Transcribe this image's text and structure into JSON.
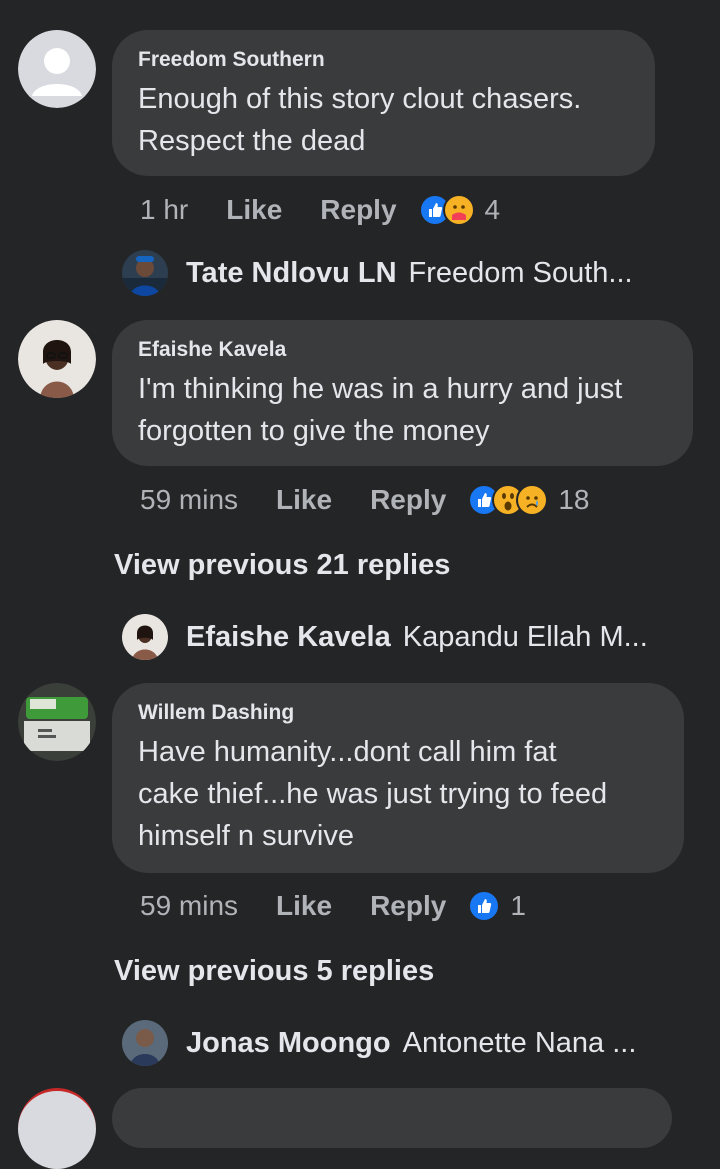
{
  "comments": [
    {
      "author": "Freedom Southern",
      "text_lines": [
        "Enough of this story clout chasers.",
        "Respect the dead"
      ],
      "time": "1 hr",
      "like": "Like",
      "reply": "Reply",
      "reactions": [
        "like",
        "care"
      ],
      "reaction_count": "4"
    },
    {
      "author": "Efaishe Kavela",
      "text_lines": [
        "I'm thinking he was in a hurry and just",
        "forgotten to give the money"
      ],
      "time": "59 mins",
      "like": "Like",
      "reply": "Reply",
      "reactions": [
        "like",
        "wow",
        "sad"
      ],
      "reaction_count": "18"
    },
    {
      "author": "Willem Dashing",
      "text_lines": [
        "Have humanity...dont call him fat",
        "cake thief...he was just trying to feed",
        "himself n survive"
      ],
      "time": "59 mins",
      "like": "Like",
      "reply": "Reply",
      "reactions": [
        "like"
      ],
      "reaction_count": "1"
    }
  ],
  "reply_previews": [
    {
      "name": "Tate Ndlovu LN",
      "text": "Freedom South..."
    },
    {
      "name": "Efaishe Kavela",
      "text": "Kapandu Ellah M..."
    },
    {
      "name": "Jonas Moongo",
      "text": "Antonette Nana ..."
    }
  ],
  "view_previous": [
    "View previous 21 replies",
    "View previous 5 replies"
  ],
  "colors": {
    "background": "#242526",
    "bubble": "#3a3b3c",
    "primary_text": "#e4e6eb",
    "secondary_text": "#b0b3b8",
    "like_blue": "#1877f2",
    "emoji_yellow": "#f7b125"
  }
}
